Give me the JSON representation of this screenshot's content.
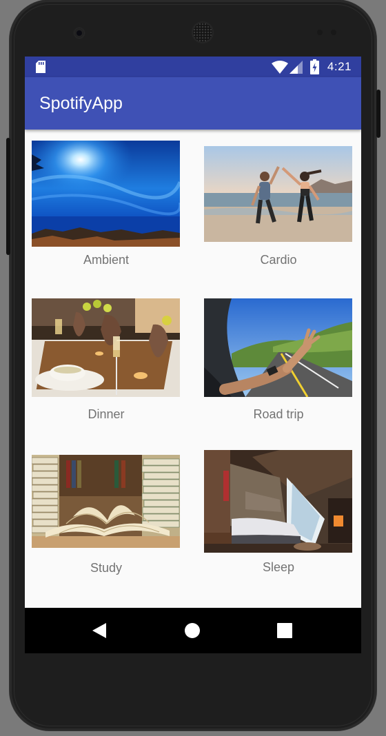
{
  "status_bar": {
    "time": "4:21",
    "icons": [
      "sd-card-icon",
      "wifi-icon",
      "cell-signal-icon",
      "battery-charging-icon"
    ]
  },
  "app_bar": {
    "title": "SpotifyApp"
  },
  "categories": [
    {
      "label": "Ambient",
      "image": "ambient-image"
    },
    {
      "label": "Cardio",
      "image": "cardio-image"
    },
    {
      "label": "Dinner",
      "image": "dinner-image"
    },
    {
      "label": "Road trip",
      "image": "road-trip-image"
    },
    {
      "label": "Study",
      "image": "study-image"
    },
    {
      "label": "Sleep",
      "image": "sleep-image"
    }
  ],
  "nav_bar": {
    "icons": [
      "back-icon",
      "home-icon",
      "recents-icon"
    ]
  },
  "colors": {
    "status_bar": "#303f9f",
    "app_bar": "#3f51b5",
    "background": "#fafafa",
    "caption_text": "#737373",
    "nav_bar": "#000000"
  }
}
